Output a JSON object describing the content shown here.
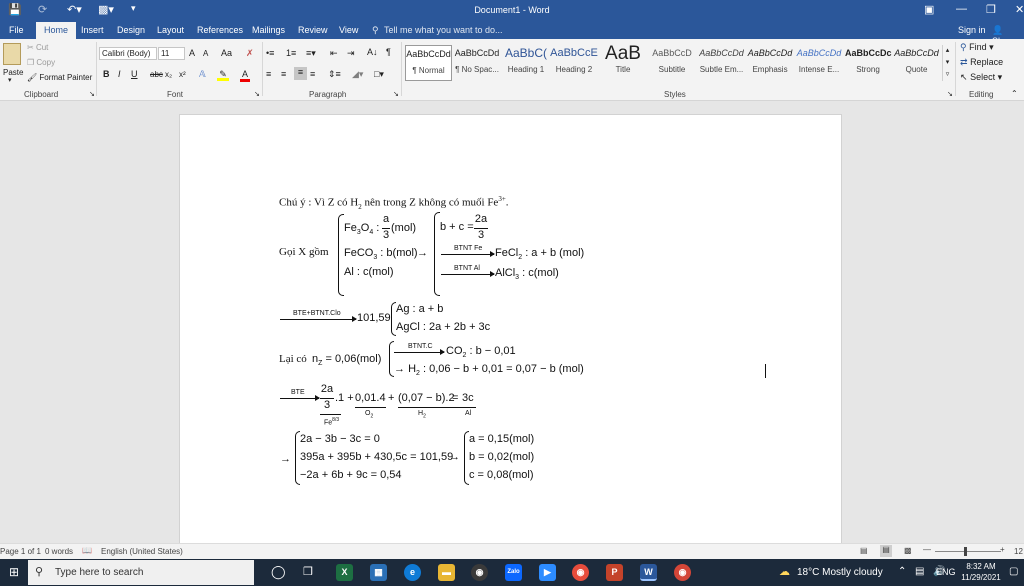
{
  "window": {
    "title": "Document1 - Word",
    "sign_in": "Sign in",
    "share": "Share"
  },
  "tabs": [
    "File",
    "Home",
    "Insert",
    "Design",
    "Layout",
    "References",
    "Mailings",
    "Review",
    "View"
  ],
  "tell_me": "Tell me what you want to do...",
  "clipboard": {
    "paste": "Paste",
    "cut": "Cut",
    "copy": "Copy",
    "format_painter": "Format Painter",
    "group": "Clipboard"
  },
  "font": {
    "name": "Calibri (Body)",
    "size": "11",
    "group": "Font",
    "bold": "B",
    "italic": "I",
    "underline": "U",
    "strike": "abc",
    "sub": "x₂",
    "sup": "x²",
    "font_color": "A",
    "grow": "A",
    "shrink": "A",
    "change_case": "Aa"
  },
  "paragraph": {
    "group": "Paragraph"
  },
  "styles": {
    "group": "Styles",
    "items": [
      {
        "preview": "AaBbCcDd",
        "name": "¶ Normal"
      },
      {
        "preview": "AaBbCcDd",
        "name": "¶ No Spac..."
      },
      {
        "preview": "AaBbC(",
        "name": "Heading 1"
      },
      {
        "preview": "AaBbCcE",
        "name": "Heading 2"
      },
      {
        "preview": "AaB",
        "name": "Title"
      },
      {
        "preview": "AaBbCcD",
        "name": "Subtitle"
      },
      {
        "preview": "AaBbCcDd",
        "name": "Subtle Em..."
      },
      {
        "preview": "AaBbCcDd",
        "name": "Emphasis"
      },
      {
        "preview": "AaBbCcDd",
        "name": "Intense E..."
      },
      {
        "preview": "AaBbCcDc",
        "name": "Strong"
      },
      {
        "preview": "AaBbCcDd",
        "name": "Quote"
      }
    ]
  },
  "editing": {
    "find": "Find",
    "replace": "Replace",
    "select": "Select",
    "group": "Editing"
  },
  "doc": {
    "note_prefix": "Chú ý : Vì Z có H",
    "note_sub": "2",
    "note_mid": " nên trong Z không có muối Fe",
    "note_sup": "3+",
    "note_end": ".",
    "goi_x": "Gọi X gồm",
    "fe3o4": "Fe",
    "fe3o4_s1": "3",
    "fe3o4_o": "O",
    "fe3o4_s2": "4",
    "fe3o4_colon": " :",
    "fe3o4_num": "a",
    "fe3o4_den": "3",
    "fe3o4_unit": "(mol)",
    "feco3": "FeCO",
    "feco3_sub": "3",
    "feco3_val": " : b(mol)",
    "al": "Al : c(mol)",
    "arrow1": "→",
    "bc_lhs": "b + c =",
    "bc_num": "2a",
    "bc_den": "3",
    "btnt_fe": "BTNT Fe",
    "fecl2": "FeCl",
    "fecl2_sub": "2",
    "fecl2_val": " : a + b (mol)",
    "btnt_al": "BTNT Al",
    "alcl3": "AlCl",
    "alcl3_sub": "3",
    "alcl3_val": " : c(mol)",
    "bte_clo": "BTE+BTNT.Clo",
    "m_10159": "101,59",
    "ag": "Ag : a + b",
    "agcl": "AgCl : 2a + 2b + 3c",
    "lai_co": "Lại có",
    "n_z": "n",
    "n_z_sub": "Z",
    "n_z_val": " = 0,06(mol)",
    "btnt_c": "BTNT.C",
    "co2": "CO",
    "co2_sub": "2",
    "co2_val": " : b − 0,01",
    "h2_arrow": "→",
    "h2": "H",
    "h2_sub": "2",
    "h2_val": " : 0,06 − b + 0,01 = 0,07 − b (mol)",
    "bte": "BTE",
    "e_num": "2a",
    "e_den": "3",
    "e_fe": "Fe",
    "e_fe_sup": "8/3",
    "e_t1": ".1 +",
    "e_t2": "0,01.4",
    "e_o2": "O",
    "e_o2_sub": "2",
    "e_plus": "+",
    "e_t3": "(0,07 − b).2",
    "e_h2": "H",
    "e_h2_sub": "2",
    "e_eq": "=",
    "e_t4": "3c",
    "e_al": "Al",
    "final_arrow": "→",
    "eq1": "2a − 3b − 3c = 0",
    "eq2": "395a + 395b + 430,5c = 101,59",
    "eq3": "−2a + 6b + 9c = 0,54",
    "mid_arrow": "→",
    "sol1": "a = 0,15(mol)",
    "sol2": "b = 0,02(mol)",
    "sol3": "c = 0,08(mol)"
  },
  "status": {
    "page": "Page 1 of 1",
    "words": "0 words",
    "language": "English (United States)",
    "zoom": "12"
  },
  "taskbar": {
    "search": "Type here to search",
    "weather": "18°C  Mostly cloudy",
    "lang": "ENG",
    "time": "8:32 AM",
    "date": "11/29/2021"
  }
}
